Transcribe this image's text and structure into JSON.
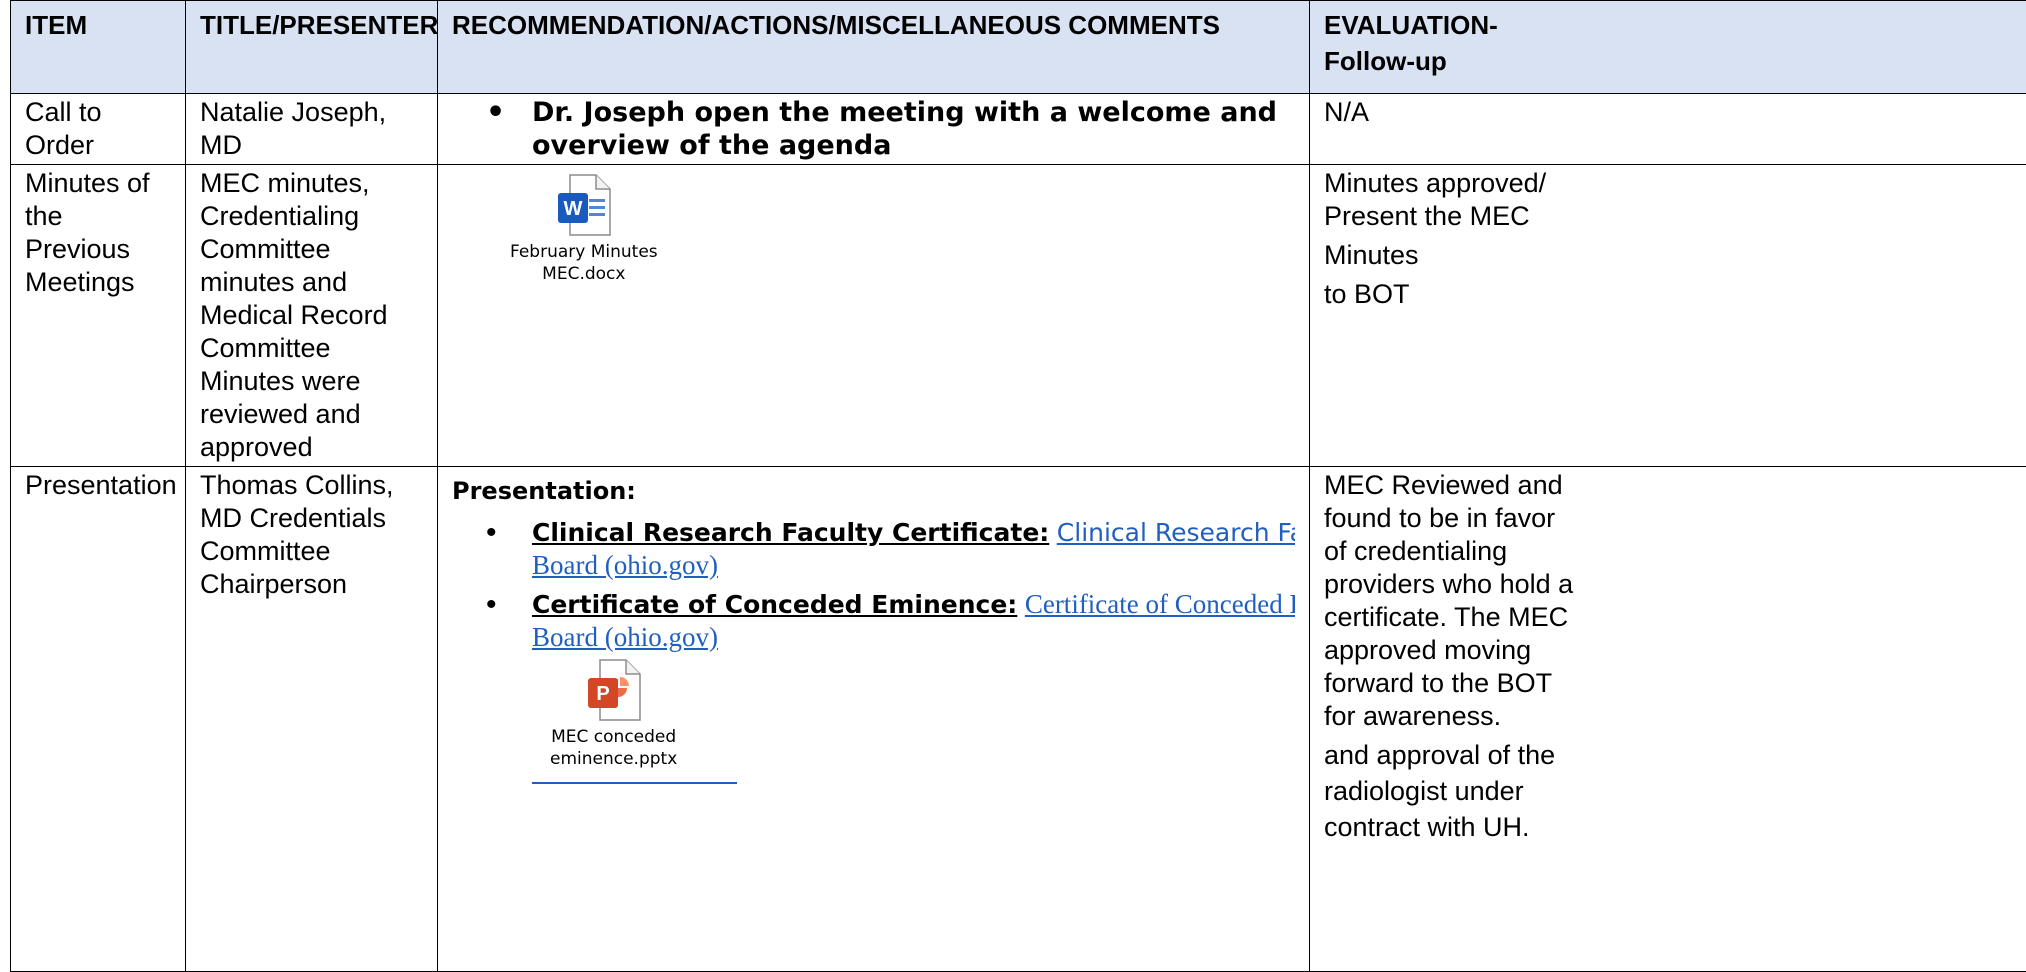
{
  "headers": {
    "item": "ITEM",
    "presenter": "TITLE/PRESENTER",
    "comments": "RECOMMENDATION/ACTIONS/MISCELLANEOUS COMMENTS",
    "evaluation_line1": "EVALUATION-",
    "evaluation_line2": "Follow-up"
  },
  "rows": [
    {
      "item": "Call to Order",
      "presenter": "Natalie Joseph, MD",
      "comment": "Dr. Joseph open the meeting with a welcome and overview of the agenda",
      "evaluation": "N/A"
    },
    {
      "item": "Minutes of the Previous Meetings",
      "presenter": "MEC minutes, Credentialing Committee minutes and Medical Record Committee Minutes were reviewed and approved",
      "attachment": {
        "line1": "February Minutes",
        "line2": "MEC.docx",
        "icon": "word-doc-icon"
      },
      "evaluation": {
        "line1": "Minutes approved/",
        "line2": "Present the MEC",
        "line3": "Minutes",
        "line4": "to BOT"
      }
    },
    {
      "item": "Presentation",
      "presenter": "Thomas Collins, MD Credentials Committee Chairperson",
      "heading": "Presentation:",
      "bullets": [
        {
          "label": "Clinical Research Faculty Certificate:",
          "link_line1": "Clinical Research Faculty Certificate | State Medical",
          "link_line2": "Board (ohio.gov)"
        },
        {
          "label": "Certificate of Conceded Eminence:",
          "link_line1": "Certificate of Conceded Eminence | State Medical",
          "link_line2": "Board (ohio.gov)"
        }
      ],
      "attachment": {
        "line1": "MEC conceded",
        "line2": "eminence.pptx",
        "icon": "powerpoint-icon"
      },
      "evaluation": {
        "para1": "MEC Reviewed and found to be in favor of credentialing providers who hold a certificate. The MEC approved moving forward to the BOT for awareness.",
        "para2": "and approval of the radiologist under contract with UH."
      }
    }
  ],
  "colors": {
    "header_bg": "#d9e2f3",
    "link": "#1f5fbf",
    "word_blue": "#185abd",
    "ppt_orange": "#d24726"
  }
}
